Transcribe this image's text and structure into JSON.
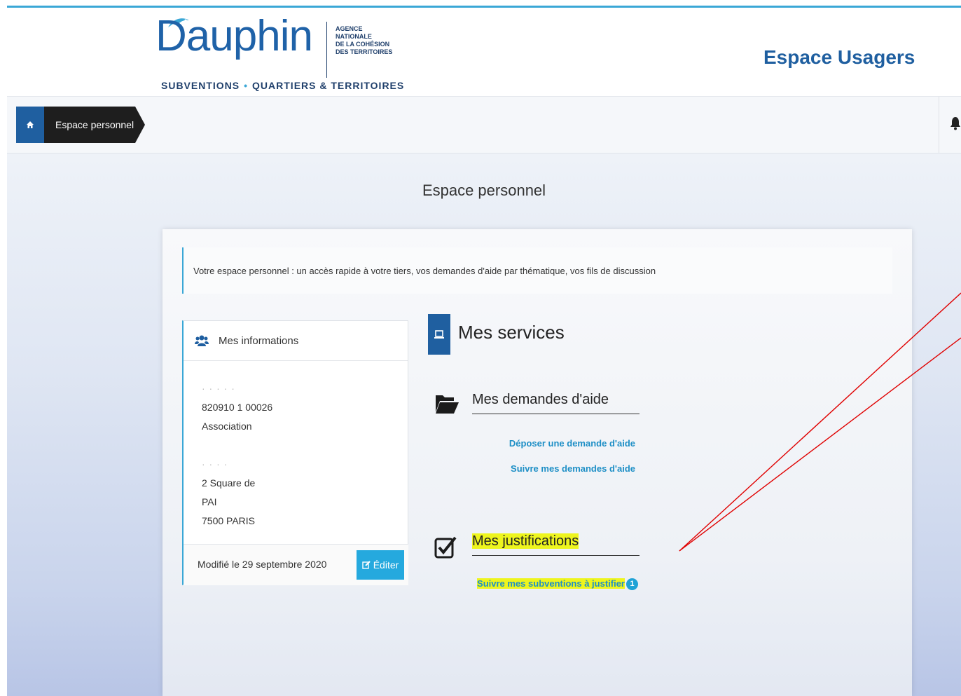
{
  "header": {
    "logo_text": "Dauphin",
    "agency_lines": [
      "AGENCE",
      "NATIONALE",
      "DE LA COHÉSION",
      "DES TERRITOIRES"
    ],
    "tagline_left": "SUBVENTIONS",
    "tagline_right": "QUARTIERS & TERRITOIRES",
    "space_title": "Espace Usagers"
  },
  "breadcrumb": {
    "home_icon": "home-icon",
    "current": "Espace personnel",
    "notification_icon": "bell-icon"
  },
  "page": {
    "title": "Espace personnel",
    "intro": "Votre espace personnel : un accès rapide à votre tiers, vos demandes d'aide par thématique, vos fils de discussion"
  },
  "info_card": {
    "title": "Mes informations",
    "icon": "users-icon",
    "lines": [
      "820910 1 00026",
      "Association",
      "",
      "2 Square de",
      "PAI",
      "7500 PARIS"
    ],
    "modified": "Modifié le 29 septembre 2020",
    "edit_label": "Éditer"
  },
  "services": {
    "title": "Mes services",
    "icon": "laptop-icon",
    "demandes": {
      "title": "Mes demandes d'aide",
      "icon": "folder-open-icon",
      "links": [
        "Déposer une demande d'aide",
        "Suivre mes demandes d'aide"
      ]
    },
    "justifications": {
      "title": "Mes justifications",
      "icon": "check-square-icon",
      "link": "Suivre mes subventions à justifier",
      "badge": "1"
    }
  },
  "colors": {
    "brand_blue": "#1f5fa0",
    "accent_cyan": "#25a9de",
    "highlight": "#eef51d",
    "annotation": "#e00000"
  }
}
